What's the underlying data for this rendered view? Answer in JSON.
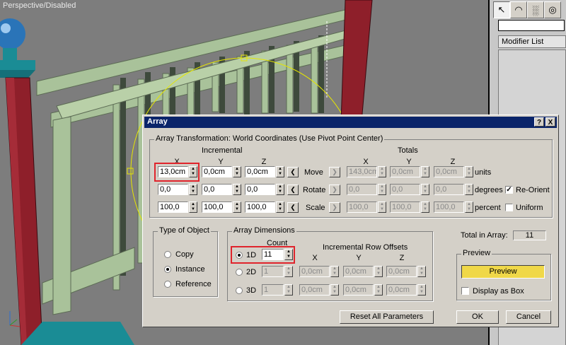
{
  "viewport": {
    "label": "Perspective/Disabled"
  },
  "command_panel": {
    "tabs": [
      "create-icon",
      "modify-icon",
      "hierarchy-icon",
      "motion-icon"
    ],
    "name_value": "",
    "modifier_list": "Modifier List"
  },
  "dialog": {
    "title": "Array",
    "help": "?",
    "close": "X",
    "transform": {
      "group_label": "Array Transformation: World Coordinates (Use Pivot Point Center)",
      "incremental": "Incremental",
      "totals": "Totals",
      "axes": [
        "X",
        "Y",
        "Z"
      ],
      "rows": [
        {
          "label": "Move",
          "inc": [
            "13,0cm",
            "0,0cm",
            "0,0cm"
          ],
          "tot": [
            "143,0cm",
            "0,0cm",
            "0,0cm"
          ],
          "unit": "units"
        },
        {
          "label": "Rotate",
          "inc": [
            "0,0",
            "0,0",
            "0,0"
          ],
          "tot": [
            "0,0",
            "0,0",
            "0,0"
          ],
          "unit": "degrees"
        },
        {
          "label": "Scale",
          "inc": [
            "100,0",
            "100,0",
            "100,0"
          ],
          "tot": [
            "100,0",
            "100,0",
            "100,0"
          ],
          "unit": "percent"
        }
      ],
      "reorient": {
        "label": "Re-Orient",
        "checked": true
      },
      "uniform": {
        "label": "Uniform",
        "checked": false
      }
    },
    "type_of_object": {
      "label": "Type of Object",
      "options": [
        "Copy",
        "Instance",
        "Reference"
      ],
      "selected": "Instance"
    },
    "array_dimensions": {
      "label": "Array Dimensions",
      "count_label": "Count",
      "offsets_label": "Incremental Row Offsets",
      "axes": [
        "X",
        "Y",
        "Z"
      ],
      "rows": [
        {
          "label": "1D",
          "count": "11",
          "selected": true
        },
        {
          "label": "2D",
          "count": "1",
          "offsets": [
            "0,0cm",
            "0,0cm",
            "0,0cm"
          ],
          "selected": false
        },
        {
          "label": "3D",
          "count": "1",
          "offsets": [
            "0,0cm",
            "0,0cm",
            "0,0cm"
          ],
          "selected": false
        }
      ]
    },
    "total_in_array": {
      "label": "Total in Array:",
      "value": "11"
    },
    "preview": {
      "label": "Preview",
      "button": "Preview",
      "display_as_box": "Display as Box",
      "display_as_box_checked": false
    },
    "buttons": {
      "reset": "Reset All Parameters",
      "ok": "OK",
      "cancel": "Cancel"
    }
  }
}
